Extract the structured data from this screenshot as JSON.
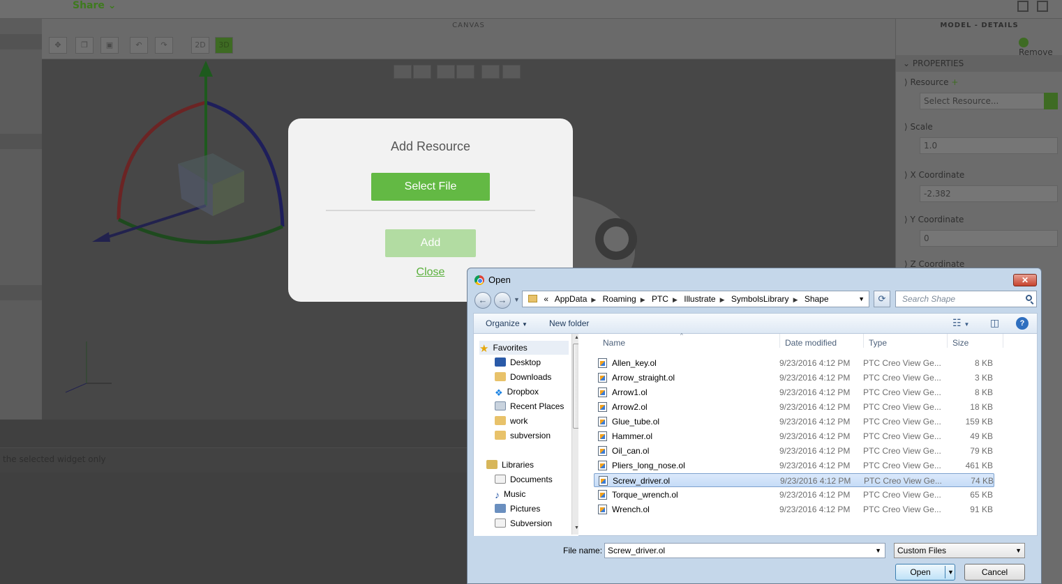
{
  "app": {
    "share_label": "Share",
    "canvas_label": "CANVAS",
    "view_2d": "2D",
    "view_3d": "3D",
    "bottom_hint": "the selected widget only"
  },
  "details_panel": {
    "title": "MODEL - DETAILS",
    "remove_label": "Remove",
    "properties_label": "PROPERTIES",
    "resource_label": "Resource",
    "resource_placeholder": "Select Resource...",
    "scale_label": "Scale",
    "scale_value": "1.0",
    "x_label": "X Coordinate",
    "x_value": "-2.382",
    "y_label": "Y Coordinate",
    "y_value": "0",
    "z_label": "Z Coordinate"
  },
  "modal": {
    "title": "Add Resource",
    "select_file_label": "Select File",
    "add_label": "Add",
    "close_label": "Close"
  },
  "open_dialog": {
    "title": "Open",
    "close_glyph": "✕",
    "breadcrumb": [
      "AppData",
      "Roaming",
      "PTC",
      "Illustrate",
      "SymbolsLibrary",
      "Shape"
    ],
    "breadcrumb_prefix": "«",
    "search_placeholder": "Search Shape",
    "organize_label": "Organize",
    "new_folder_label": "New folder",
    "nav": {
      "favorites_label": "Favorites",
      "favorites": [
        "Desktop",
        "Downloads",
        "Dropbox",
        "Recent Places",
        "work",
        "subversion"
      ],
      "libraries_label": "Libraries",
      "libraries": [
        "Documents",
        "Music",
        "Pictures",
        "Subversion"
      ]
    },
    "columns": [
      "Name",
      "Date modified",
      "Type",
      "Size"
    ],
    "files": [
      {
        "name": "Allen_key.ol",
        "date": "9/23/2016 4:12 PM",
        "type": "PTC Creo View Ge...",
        "size": "8 KB"
      },
      {
        "name": "Arrow_straight.ol",
        "date": "9/23/2016 4:12 PM",
        "type": "PTC Creo View Ge...",
        "size": "3 KB"
      },
      {
        "name": "Arrow1.ol",
        "date": "9/23/2016 4:12 PM",
        "type": "PTC Creo View Ge...",
        "size": "8 KB"
      },
      {
        "name": "Arrow2.ol",
        "date": "9/23/2016 4:12 PM",
        "type": "PTC Creo View Ge...",
        "size": "18 KB"
      },
      {
        "name": "Glue_tube.ol",
        "date": "9/23/2016 4:12 PM",
        "type": "PTC Creo View Ge...",
        "size": "159 KB"
      },
      {
        "name": "Hammer.ol",
        "date": "9/23/2016 4:12 PM",
        "type": "PTC Creo View Ge...",
        "size": "49 KB"
      },
      {
        "name": "Oil_can.ol",
        "date": "9/23/2016 4:12 PM",
        "type": "PTC Creo View Ge...",
        "size": "79 KB"
      },
      {
        "name": "Pliers_long_nose.ol",
        "date": "9/23/2016 4:12 PM",
        "type": "PTC Creo View Ge...",
        "size": "461 KB"
      },
      {
        "name": "Screw_driver.ol",
        "date": "9/23/2016 4:12 PM",
        "type": "PTC Creo View Ge...",
        "size": "74 KB"
      },
      {
        "name": "Torque_wrench.ol",
        "date": "9/23/2016 4:12 PM",
        "type": "PTC Creo View Ge...",
        "size": "65 KB"
      },
      {
        "name": "Wrench.ol",
        "date": "9/23/2016 4:12 PM",
        "type": "PTC Creo View Ge...",
        "size": "91 KB"
      }
    ],
    "selected_file": "Screw_driver.ol",
    "file_name_label": "File name:",
    "file_name_value": "Screw_driver.ol",
    "filter_value": "Custom Files",
    "open_label": "Open",
    "cancel_label": "Cancel"
  },
  "colors": {
    "accent_green": "#63b944",
    "add_disabled": "#b2dca2",
    "selection_blue": "#c6dcf7"
  }
}
